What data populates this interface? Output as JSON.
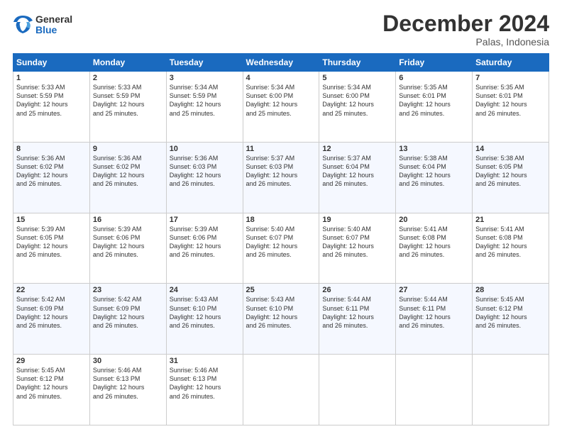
{
  "logo": {
    "general": "General",
    "blue": "Blue"
  },
  "title": "December 2024",
  "subtitle": "Palas, Indonesia",
  "days_of_week": [
    "Sunday",
    "Monday",
    "Tuesday",
    "Wednesday",
    "Thursday",
    "Friday",
    "Saturday"
  ],
  "weeks": [
    [
      {
        "day": "1",
        "sunrise": "5:33 AM",
        "sunset": "5:59 PM",
        "daylight": "12 hours and 25 minutes."
      },
      {
        "day": "2",
        "sunrise": "5:33 AM",
        "sunset": "5:59 PM",
        "daylight": "12 hours and 25 minutes."
      },
      {
        "day": "3",
        "sunrise": "5:34 AM",
        "sunset": "5:59 PM",
        "daylight": "12 hours and 25 minutes."
      },
      {
        "day": "4",
        "sunrise": "5:34 AM",
        "sunset": "6:00 PM",
        "daylight": "12 hours and 25 minutes."
      },
      {
        "day": "5",
        "sunrise": "5:34 AM",
        "sunset": "6:00 PM",
        "daylight": "12 hours and 25 minutes."
      },
      {
        "day": "6",
        "sunrise": "5:35 AM",
        "sunset": "6:01 PM",
        "daylight": "12 hours and 26 minutes."
      },
      {
        "day": "7",
        "sunrise": "5:35 AM",
        "sunset": "6:01 PM",
        "daylight": "12 hours and 26 minutes."
      }
    ],
    [
      {
        "day": "8",
        "sunrise": "5:36 AM",
        "sunset": "6:02 PM",
        "daylight": "12 hours and 26 minutes."
      },
      {
        "day": "9",
        "sunrise": "5:36 AM",
        "sunset": "6:02 PM",
        "daylight": "12 hours and 26 minutes."
      },
      {
        "day": "10",
        "sunrise": "5:36 AM",
        "sunset": "6:03 PM",
        "daylight": "12 hours and 26 minutes."
      },
      {
        "day": "11",
        "sunrise": "5:37 AM",
        "sunset": "6:03 PM",
        "daylight": "12 hours and 26 minutes."
      },
      {
        "day": "12",
        "sunrise": "5:37 AM",
        "sunset": "6:04 PM",
        "daylight": "12 hours and 26 minutes."
      },
      {
        "day": "13",
        "sunrise": "5:38 AM",
        "sunset": "6:04 PM",
        "daylight": "12 hours and 26 minutes."
      },
      {
        "day": "14",
        "sunrise": "5:38 AM",
        "sunset": "6:05 PM",
        "daylight": "12 hours and 26 minutes."
      }
    ],
    [
      {
        "day": "15",
        "sunrise": "5:39 AM",
        "sunset": "6:05 PM",
        "daylight": "12 hours and 26 minutes."
      },
      {
        "day": "16",
        "sunrise": "5:39 AM",
        "sunset": "6:06 PM",
        "daylight": "12 hours and 26 minutes."
      },
      {
        "day": "17",
        "sunrise": "5:39 AM",
        "sunset": "6:06 PM",
        "daylight": "12 hours and 26 minutes."
      },
      {
        "day": "18",
        "sunrise": "5:40 AM",
        "sunset": "6:07 PM",
        "daylight": "12 hours and 26 minutes."
      },
      {
        "day": "19",
        "sunrise": "5:40 AM",
        "sunset": "6:07 PM",
        "daylight": "12 hours and 26 minutes."
      },
      {
        "day": "20",
        "sunrise": "5:41 AM",
        "sunset": "6:08 PM",
        "daylight": "12 hours and 26 minutes."
      },
      {
        "day": "21",
        "sunrise": "5:41 AM",
        "sunset": "6:08 PM",
        "daylight": "12 hours and 26 minutes."
      }
    ],
    [
      {
        "day": "22",
        "sunrise": "5:42 AM",
        "sunset": "6:09 PM",
        "daylight": "12 hours and 26 minutes."
      },
      {
        "day": "23",
        "sunrise": "5:42 AM",
        "sunset": "6:09 PM",
        "daylight": "12 hours and 26 minutes."
      },
      {
        "day": "24",
        "sunrise": "5:43 AM",
        "sunset": "6:10 PM",
        "daylight": "12 hours and 26 minutes."
      },
      {
        "day": "25",
        "sunrise": "5:43 AM",
        "sunset": "6:10 PM",
        "daylight": "12 hours and 26 minutes."
      },
      {
        "day": "26",
        "sunrise": "5:44 AM",
        "sunset": "6:11 PM",
        "daylight": "12 hours and 26 minutes."
      },
      {
        "day": "27",
        "sunrise": "5:44 AM",
        "sunset": "6:11 PM",
        "daylight": "12 hours and 26 minutes."
      },
      {
        "day": "28",
        "sunrise": "5:45 AM",
        "sunset": "6:12 PM",
        "daylight": "12 hours and 26 minutes."
      }
    ],
    [
      {
        "day": "29",
        "sunrise": "5:45 AM",
        "sunset": "6:12 PM",
        "daylight": "12 hours and 26 minutes."
      },
      {
        "day": "30",
        "sunrise": "5:46 AM",
        "sunset": "6:13 PM",
        "daylight": "12 hours and 26 minutes."
      },
      {
        "day": "31",
        "sunrise": "5:46 AM",
        "sunset": "6:13 PM",
        "daylight": "12 hours and 26 minutes."
      },
      null,
      null,
      null,
      null
    ]
  ],
  "labels": {
    "sunrise": "Sunrise: ",
    "sunset": "Sunset: ",
    "daylight": "Daylight: "
  }
}
